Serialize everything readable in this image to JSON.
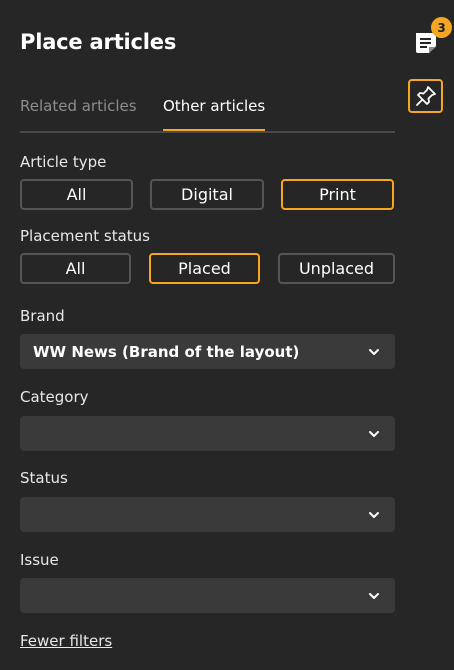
{
  "panel": {
    "title": "Place articles",
    "tabs": [
      {
        "label": "Related articles",
        "active": false
      },
      {
        "label": "Other articles",
        "active": true
      }
    ]
  },
  "filters": {
    "article_type": {
      "label": "Article type",
      "options": [
        "All",
        "Digital",
        "Print"
      ],
      "selected": "Print"
    },
    "placement_status": {
      "label": "Placement status",
      "options": [
        "All",
        "Placed",
        "Unplaced"
      ],
      "selected": "Placed"
    },
    "brand": {
      "label": "Brand",
      "value": "WW News (Brand of the layout)"
    },
    "category": {
      "label": "Category",
      "value": ""
    },
    "status": {
      "label": "Status",
      "value": ""
    },
    "issue": {
      "label": "Issue",
      "value": ""
    },
    "fewer_filters_label": "Fewer filters"
  },
  "side_toolbar": {
    "notes_count": "3",
    "notes_icon": "notes-icon",
    "pin_icon": "pin-icon"
  },
  "colors": {
    "background": "#262626",
    "accent": "#f5a623",
    "field": "#3a3a3a",
    "border": "#555555",
    "muted_text": "#8d8d8d"
  }
}
